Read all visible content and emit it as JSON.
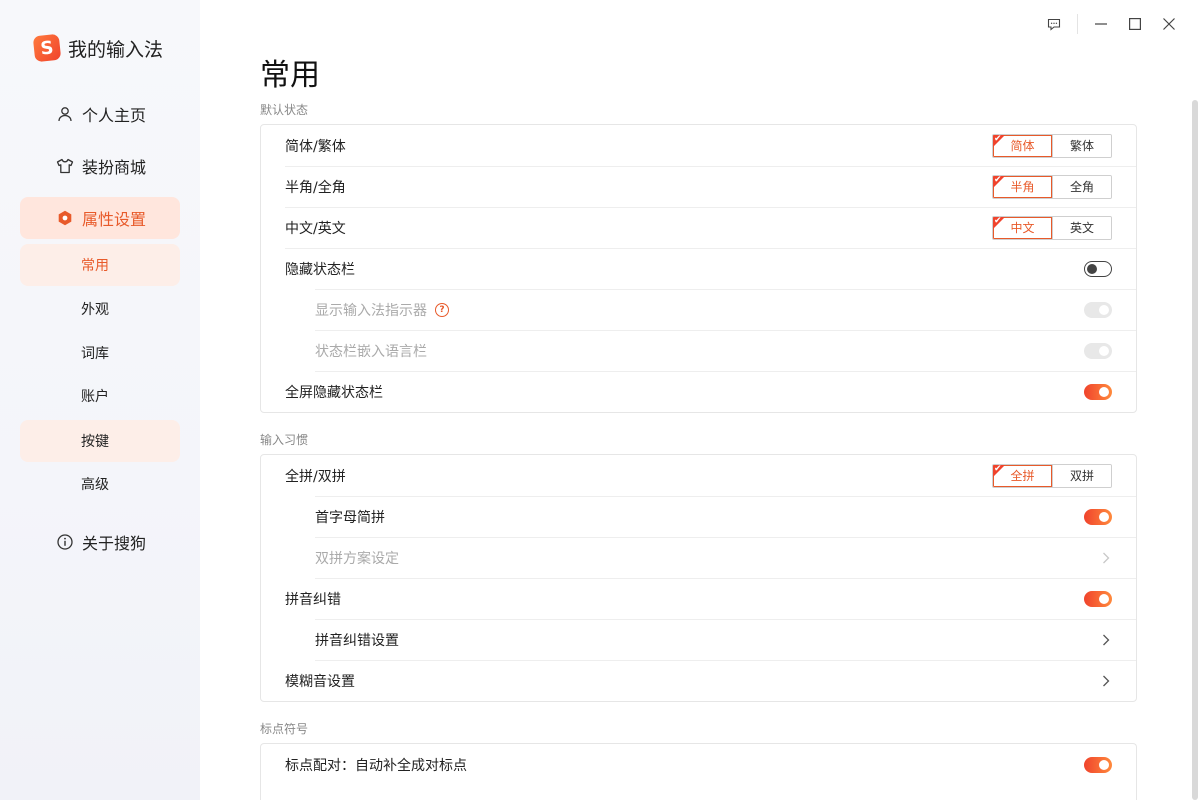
{
  "app": {
    "name": "我的输入法",
    "logo_letter": "S",
    "accent": "#e85a2a"
  },
  "nav": {
    "profile": "个人主页",
    "store": "装扮商城",
    "settings": "属性设置",
    "sub": [
      "常用",
      "外观",
      "词库",
      "账户",
      "按键",
      "高级"
    ],
    "about": "关于搜狗"
  },
  "page": {
    "title": "常用"
  },
  "sections": {
    "default_state": {
      "title": "默认状态",
      "rows": [
        {
          "label": "简体/繁体",
          "options": [
            "简体",
            "繁体"
          ],
          "selected": 0
        },
        {
          "label": "半角/全角",
          "options": [
            "半角",
            "全角"
          ],
          "selected": 0
        },
        {
          "label": "中文/英文",
          "options": [
            "中文",
            "英文"
          ],
          "selected": 0
        },
        {
          "label": "隐藏状态栏",
          "toggle": "off"
        },
        {
          "label": "显示输入法指示器",
          "toggle": "on",
          "disabled": true
        },
        {
          "label": "状态栏嵌入语言栏",
          "toggle": "on",
          "disabled": true
        },
        {
          "label": "全屏隐藏状态栏",
          "toggle": "on"
        }
      ]
    },
    "input_habit": {
      "title": "输入习惯",
      "rows": [
        {
          "label": "全拼/双拼",
          "options": [
            "全拼",
            "双拼"
          ],
          "selected": 0
        },
        {
          "label": "首字母简拼",
          "toggle": "on"
        },
        {
          "label": "双拼方案设定",
          "disabled": true
        },
        {
          "label": "拼音纠错",
          "toggle": "on"
        },
        {
          "label": "拼音纠错设置"
        },
        {
          "label": "模糊音设置"
        }
      ]
    },
    "punctuation": {
      "title": "标点符号",
      "rows": [
        {
          "label": "标点配对：自动补全成对标点",
          "toggle": "on"
        }
      ]
    }
  }
}
